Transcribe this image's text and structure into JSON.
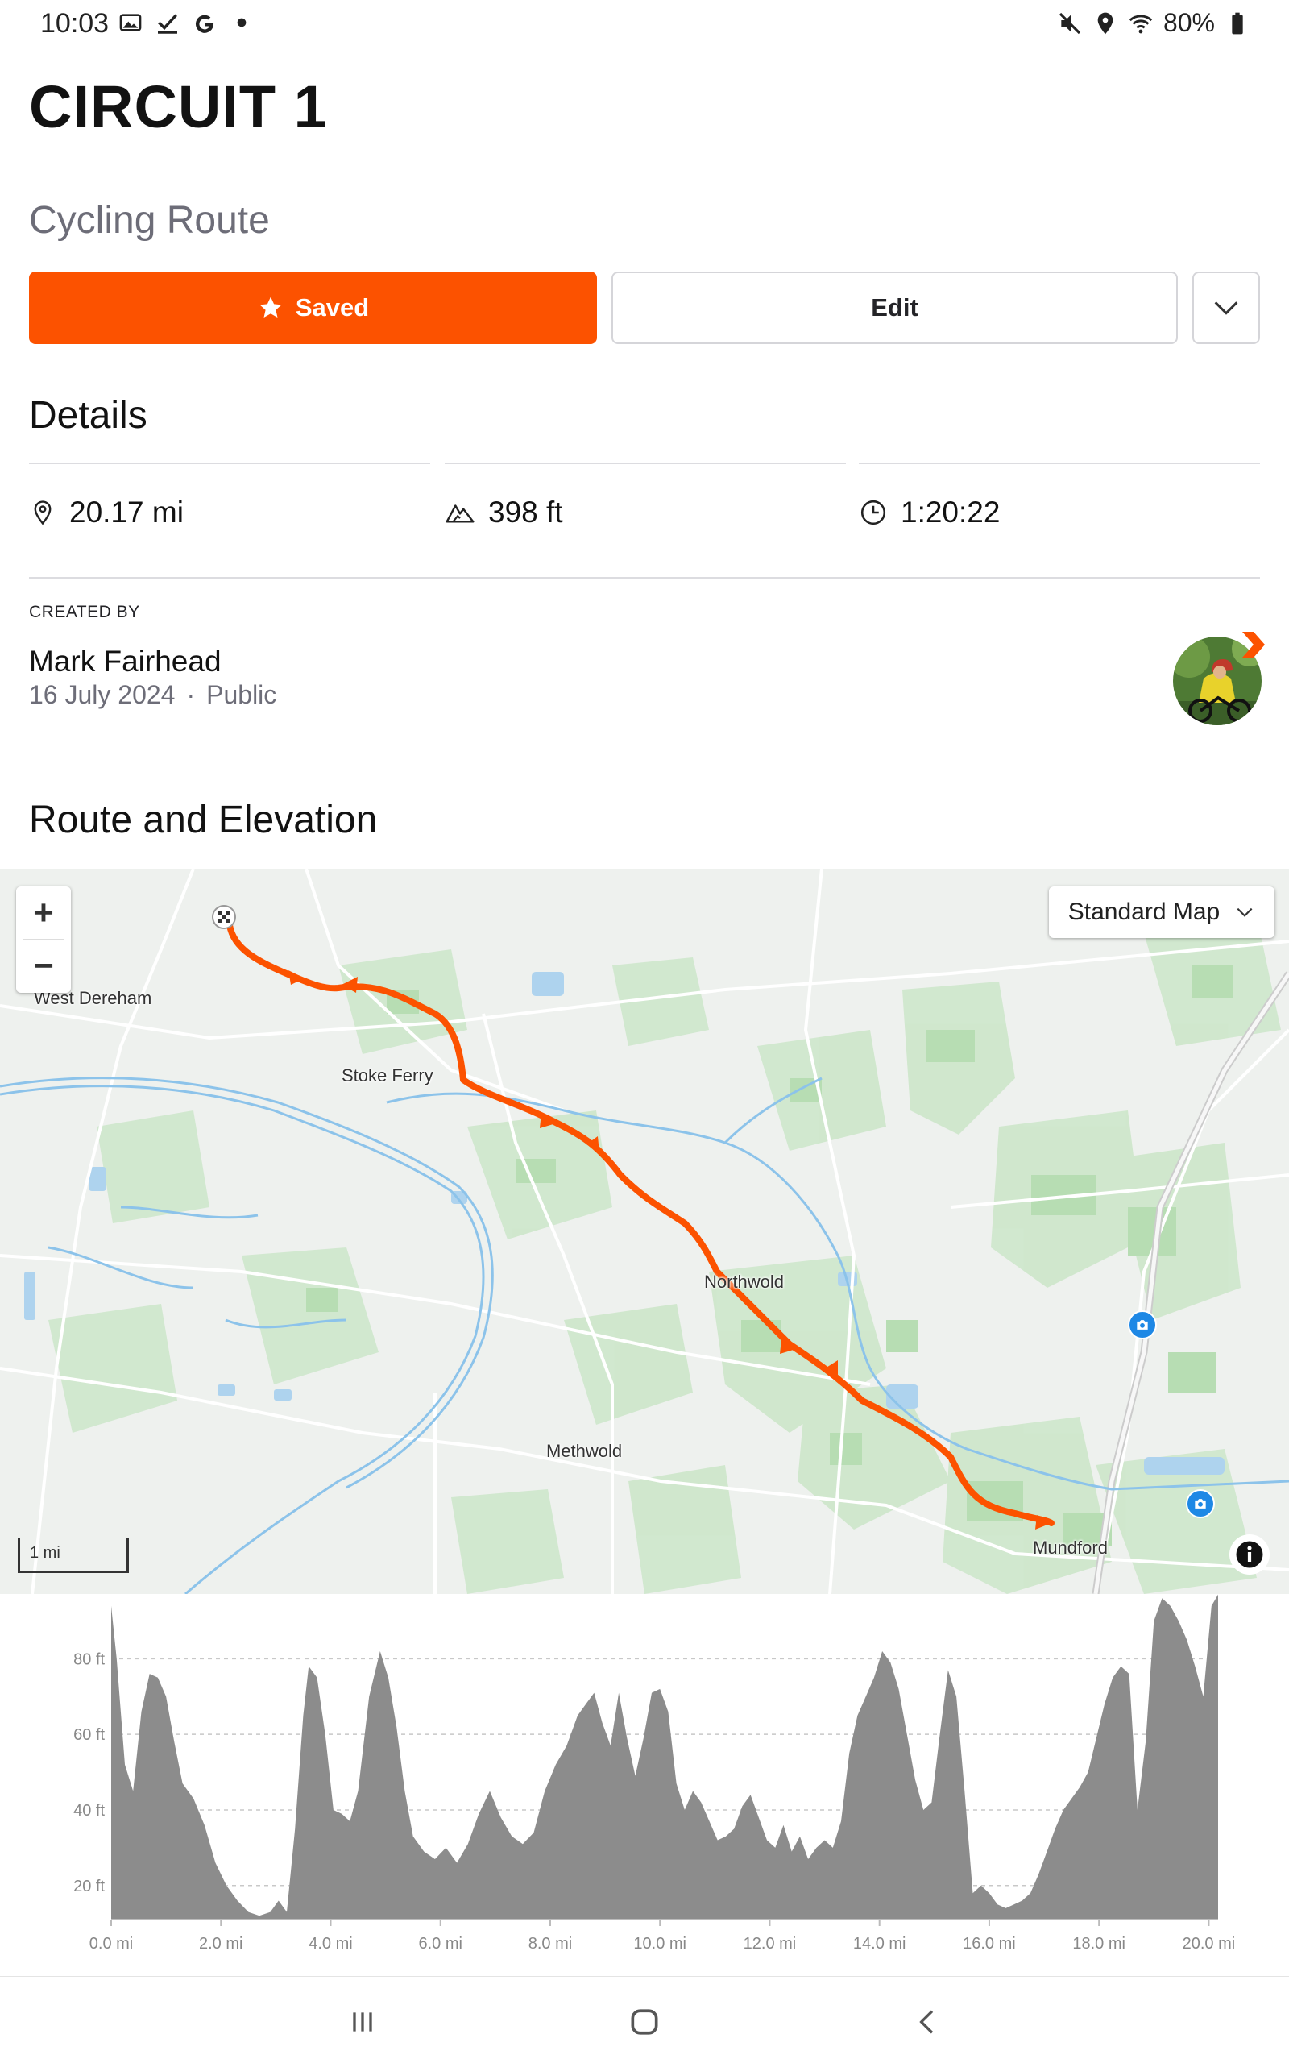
{
  "status_bar": {
    "time": "10:03",
    "battery": "80%",
    "left_icons": [
      "gallery-icon",
      "checkmark-icon",
      "google-icon",
      "dot-icon"
    ],
    "right_icons": [
      "mute-icon",
      "location-icon",
      "wifi-icon",
      "battery-icon"
    ]
  },
  "route": {
    "title": "CIRCUIT 1",
    "type": "Cycling Route"
  },
  "actions": {
    "saved_label": "Saved",
    "edit_label": "Edit"
  },
  "details": {
    "heading": "Details",
    "distance": "20.17 mi",
    "elevation": "398 ft",
    "time": "1:20:22"
  },
  "creator": {
    "label": "CREATED BY",
    "name": "Mark Fairhead",
    "date": "16 July 2024",
    "separator": "·",
    "visibility": "Public"
  },
  "map": {
    "heading": "Route and Elevation",
    "map_type": "Standard Map",
    "zoom_in": "+",
    "zoom_out": "−",
    "scale_label": "1 mi",
    "places": [
      "West Dereham",
      "Stoke Ferry",
      "Northwold",
      "Methwold",
      "Mundford"
    ],
    "route_color": "#fc5200"
  },
  "chart_data": {
    "type": "area",
    "xlabel": "",
    "ylabel": "",
    "x_ticks": [
      "0.0 mi",
      "2.0 mi",
      "4.0 mi",
      "6.0 mi",
      "8.0 mi",
      "10.0 mi",
      "12.0 mi",
      "14.0 mi",
      "16.0 mi",
      "18.0 mi",
      "20.0 mi"
    ],
    "y_ticks": [
      "20 ft",
      "40 ft",
      "60 ft",
      "80 ft"
    ],
    "xlim": [
      0,
      20.17
    ],
    "ylim": [
      11,
      95
    ],
    "grid": true,
    "series": [
      {
        "x": [
          0,
          0.1,
          0.25,
          0.4,
          0.55,
          0.7,
          0.85,
          1.0,
          1.15,
          1.3,
          1.5,
          1.7,
          1.9,
          2.1,
          2.3,
          2.5,
          2.7,
          2.9,
          3.05,
          3.2,
          3.35,
          3.5,
          3.6,
          3.75,
          3.9,
          4.05,
          4.2,
          4.35,
          4.5,
          4.7,
          4.9,
          5.05,
          5.2,
          5.35,
          5.5,
          5.7,
          5.9,
          6.1,
          6.3,
          6.5,
          6.7,
          6.9,
          7.1,
          7.3,
          7.5,
          7.7,
          7.9,
          8.1,
          8.3,
          8.5,
          8.65,
          8.8,
          8.95,
          9.1,
          9.25,
          9.4,
          9.55,
          9.7,
          9.85,
          10.0,
          10.15,
          10.3,
          10.45,
          10.6,
          10.75,
          10.9,
          11.05,
          11.2,
          11.35,
          11.5,
          11.65,
          11.8,
          11.95,
          12.1,
          12.25,
          12.4,
          12.55,
          12.7,
          12.85,
          13.0,
          13.15,
          13.3,
          13.45,
          13.6,
          13.75,
          13.9,
          14.05,
          14.2,
          14.35,
          14.5,
          14.65,
          14.8,
          14.95,
          15.1,
          15.25,
          15.4,
          15.55,
          15.7,
          15.85,
          16.0,
          16.15,
          16.3,
          16.45,
          16.6,
          16.75,
          16.9,
          17.05,
          17.2,
          17.35,
          17.5,
          17.65,
          17.8,
          17.95,
          18.1,
          18.25,
          18.4,
          18.55,
          18.7,
          18.85,
          19.0,
          19.15,
          19.3,
          19.45,
          19.6,
          19.75,
          19.9,
          20.05,
          20.17
        ],
        "y": [
          94,
          80,
          52,
          45,
          66,
          76,
          75,
          70,
          58,
          47,
          43,
          36,
          26,
          20,
          16,
          13,
          12,
          13,
          16,
          13,
          35,
          65,
          78,
          75,
          60,
          40,
          39,
          37,
          45,
          70,
          82,
          75,
          62,
          45,
          33,
          29,
          27,
          30,
          26,
          31,
          39,
          45,
          38,
          33,
          31,
          34,
          45,
          52,
          57,
          65,
          68,
          71,
          63,
          57,
          71,
          59,
          49,
          59,
          71,
          72,
          66,
          47,
          40,
          45,
          42,
          37,
          32,
          33,
          35,
          41,
          44,
          38,
          32,
          30,
          36,
          29,
          33,
          27,
          30,
          32,
          30,
          37,
          55,
          65,
          70,
          75,
          82,
          79,
          72,
          60,
          48,
          40,
          42,
          60,
          77,
          70,
          45,
          18,
          20,
          18,
          15,
          14,
          15,
          16,
          18,
          23,
          29,
          35,
          40,
          43,
          46,
          50,
          59,
          68,
          75,
          78,
          76,
          40,
          58,
          90,
          96,
          94,
          90,
          85,
          78,
          70,
          94,
          97
        ]
      }
    ]
  },
  "nav": {
    "icons": [
      "recent-apps-icon",
      "home-icon",
      "back-icon"
    ]
  }
}
